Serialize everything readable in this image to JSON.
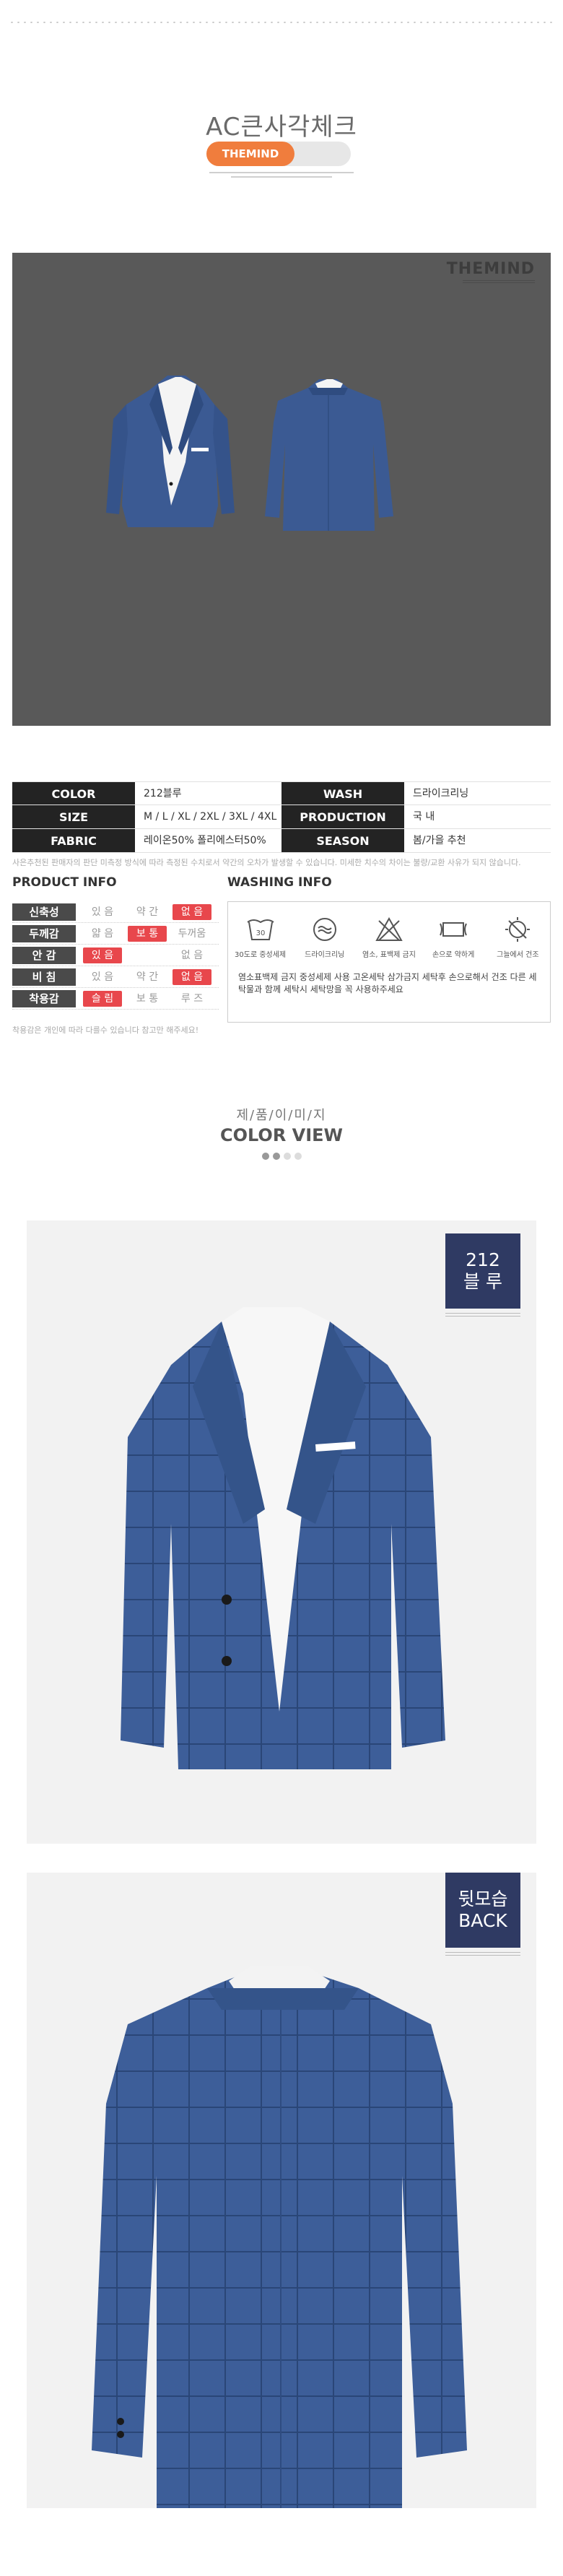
{
  "hero": {
    "title": "AC큰사각체크",
    "brand_pill": "THEMIND"
  },
  "photo_main": {
    "logo": "THEMIND"
  },
  "spec": {
    "rows": [
      {
        "l1": "COLOR",
        "v1": "212블루",
        "l2": "WASH",
        "v2": "드라이크리닝"
      },
      {
        "l1": "SIZE",
        "v1": "M / L / XL / 2XL / 3XL / 4XL",
        "l2": "PRODUCTION",
        "v2": "국 내"
      },
      {
        "l1": "FABRIC",
        "v1": "레이온50% 폴리에스터50%",
        "l2": "SEASON",
        "v2": "봄/가을 추천"
      }
    ],
    "notice": "사은추천된 판매자의 판단 미측정 방식에 따라 측정된 수치로서 약간의 오차가 발생할 수 있습니다. 미세한 치수의 차이는 불량/교환 사유가 되지 않습니다."
  },
  "product_info": {
    "title": "PRODUCT INFO",
    "rows": [
      {
        "label": "신축성",
        "opts": [
          "있 음",
          "약 간",
          "없 음"
        ],
        "sel": 2
      },
      {
        "label": "두께감",
        "opts": [
          "얇 음",
          "보 통",
          "두꺼움"
        ],
        "sel": 1
      },
      {
        "label": "안 감",
        "opts": [
          "있 음",
          "",
          "없 음"
        ],
        "sel": 0
      },
      {
        "label": "비 침",
        "opts": [
          "있 음",
          "약 간",
          "없 음"
        ],
        "sel": 2
      },
      {
        "label": "착용감",
        "opts": [
          "슬 림",
          "보 통",
          "루 즈"
        ],
        "sel": 0
      }
    ],
    "note": "착용감은 개인에 따라 다를수 있습니다 참고만 해주세요!"
  },
  "washing_info": {
    "title": "WASHING INFO",
    "icons": [
      {
        "icon": "wash-30-icon",
        "caption": "30도로 중성세제"
      },
      {
        "icon": "dry-clean-icon",
        "caption": "드라이크리닝"
      },
      {
        "icon": "no-bleach-icon",
        "caption": "염소, 표백제 금지"
      },
      {
        "icon": "hand-wring-icon",
        "caption": "손으로 약하게"
      },
      {
        "icon": "shade-dry-icon",
        "caption": "그늘에서 건조"
      }
    ],
    "text": "염소표백제 금지 중성세제 사용 고온세탁 삼가금지 세탁후 손으로해서 건조 다른 세탁물과 함께 세탁시 세탁망을 꼭 사용하주세요"
  },
  "color_view": {
    "sub": "제/품/이/미/지",
    "title": "COLOR VIEW"
  },
  "tags": {
    "front_line1": "212",
    "front_line2": "블 루",
    "back_line1": "뒷모습",
    "back_line2": "BACK"
  },
  "colors": {
    "orange": "#f07d3d",
    "navy_tag": "#2f3a63",
    "selected_red": "#e8474c",
    "jacket_blue": "#3b5a93"
  }
}
